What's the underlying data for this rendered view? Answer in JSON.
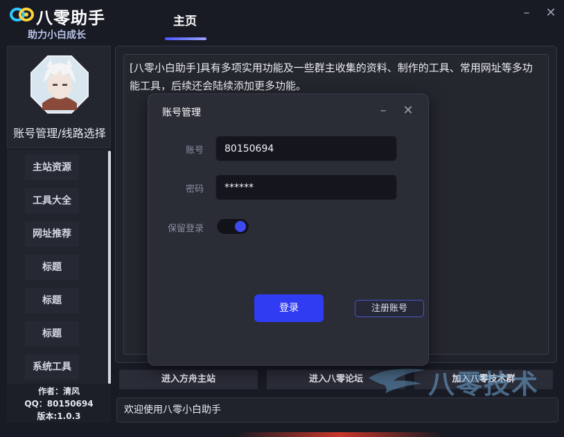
{
  "app": {
    "logo_text": "八零助手",
    "slogan": "助力小白成长"
  },
  "nav": {
    "active_tab": "主页"
  },
  "window": {
    "minimize_glyph": "–",
    "close_glyph": "✕"
  },
  "profile": {
    "label": "账号管理/线路选择"
  },
  "sidebar": {
    "items": [
      {
        "label": "主站资源"
      },
      {
        "label": "工具大全"
      },
      {
        "label": "网址推荐"
      },
      {
        "label": "标题"
      },
      {
        "label": "标题"
      },
      {
        "label": "标题"
      },
      {
        "label": "系统工具"
      }
    ]
  },
  "author_info": {
    "author": "作者：清风",
    "qq": "QQ：80150694",
    "version": "版本:1.0.3"
  },
  "main": {
    "intro_text": "[八零小白助手]具有多项实用功能及一些群主收集的资料、制作的工具、常用网址等多功能工具，后续还会陆续添加更多功能。"
  },
  "bottom_buttons": {
    "fangzhou": "进入方舟主站",
    "forum": "进入八零论坛",
    "group": "加入八零技术群"
  },
  "status": {
    "welcome": "欢迎使用八零小白助手"
  },
  "dialog": {
    "title": "账号管理",
    "account_label": "账号",
    "account_value": "80150694",
    "password_label": "密码",
    "password_value": "******",
    "remember_label": "保留登录",
    "remember_on": true,
    "login_label": "登录",
    "register_label": "注册账号"
  },
  "watermark": {
    "text": "八零技术"
  },
  "colors": {
    "background": "#181a24",
    "accent": "#2f3cf2",
    "panel": "#23252f"
  }
}
